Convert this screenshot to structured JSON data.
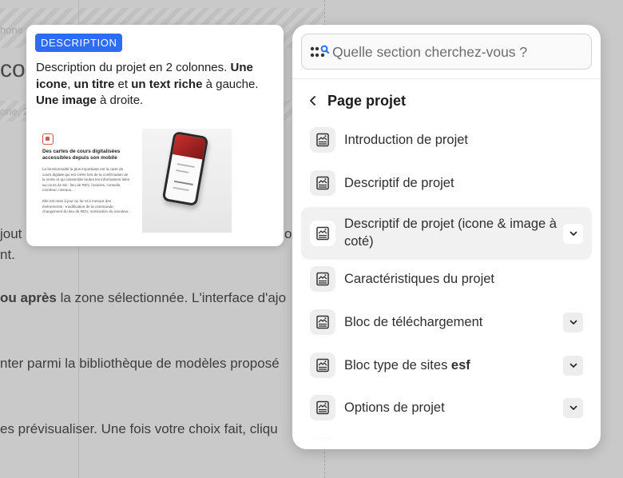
{
  "background": {
    "small_top": "hone",
    "heading": "co",
    "small_mid": "one, 2",
    "line1_start": "jout",
    "line1_end": "o",
    "line2": "nt.",
    "line3_bold": "ou après",
    "line3_rest": " la zone sélectionnée. L'interface d'ajo",
    "line4": "nter parmi la bibliothèque de modèles proposé",
    "line5": "es prévisualiser. Une fois votre choix fait, cliqu"
  },
  "preview": {
    "badge": "DESCRIPTION",
    "desc_1": "Description du projet en 2 colonnes. ",
    "desc_b1": "Une icone",
    "desc_2": ", ",
    "desc_b2": "un titre",
    "desc_3": " et ",
    "desc_b3": "un text riche",
    "desc_4": " à gauche. ",
    "desc_b4": "Une image",
    "desc_5": " à droite.",
    "thumb_title": "Des cartes de cours digitalisées accessibles depuis son mobile",
    "thumb_body": "La fonctionnalité la plus importante est la carte de cours digitale qui est créée lors de la confirmation de la vente et qui rassemble toutes les informations liées au cours de ski : lieu de RDV, horaires, conseils, moniteur, niveaux...",
    "thumb_body2": "Elle est mise à jour au fur et à mesure des événements : modification de la commande, changement du lieu de RDV, nomination du moniteur..."
  },
  "panel": {
    "search_placeholder": "Quelle section cherchez-vous ?",
    "back_title": "Page projet",
    "items": [
      {
        "label": "Introduction de projet",
        "bold": "",
        "has_chevron": false,
        "active": false
      },
      {
        "label": "Descriptif de projet",
        "bold": "",
        "has_chevron": false,
        "active": false
      },
      {
        "label": "Descriptif de projet (icone & image à coté)",
        "bold": "",
        "has_chevron": true,
        "active": true
      },
      {
        "label": "Caractéristiques du projet",
        "bold": "",
        "has_chevron": false,
        "active": false
      },
      {
        "label": "Bloc de téléchargement",
        "bold": "",
        "has_chevron": true,
        "active": false
      },
      {
        "label": "Bloc type de sites ",
        "bold": "esf",
        "has_chevron": true,
        "active": false
      },
      {
        "label": "Options de projet",
        "bold": "",
        "has_chevron": true,
        "active": false
      }
    ]
  },
  "icons": {
    "search": "search-dots-icon",
    "back": "chevron-left-icon",
    "item": "section-template-icon",
    "expand": "chevron-down-icon"
  },
  "colors": {
    "accent": "#2d6cf6",
    "overlay": "#c9c9c9",
    "active_row": "#f1f1f1"
  }
}
